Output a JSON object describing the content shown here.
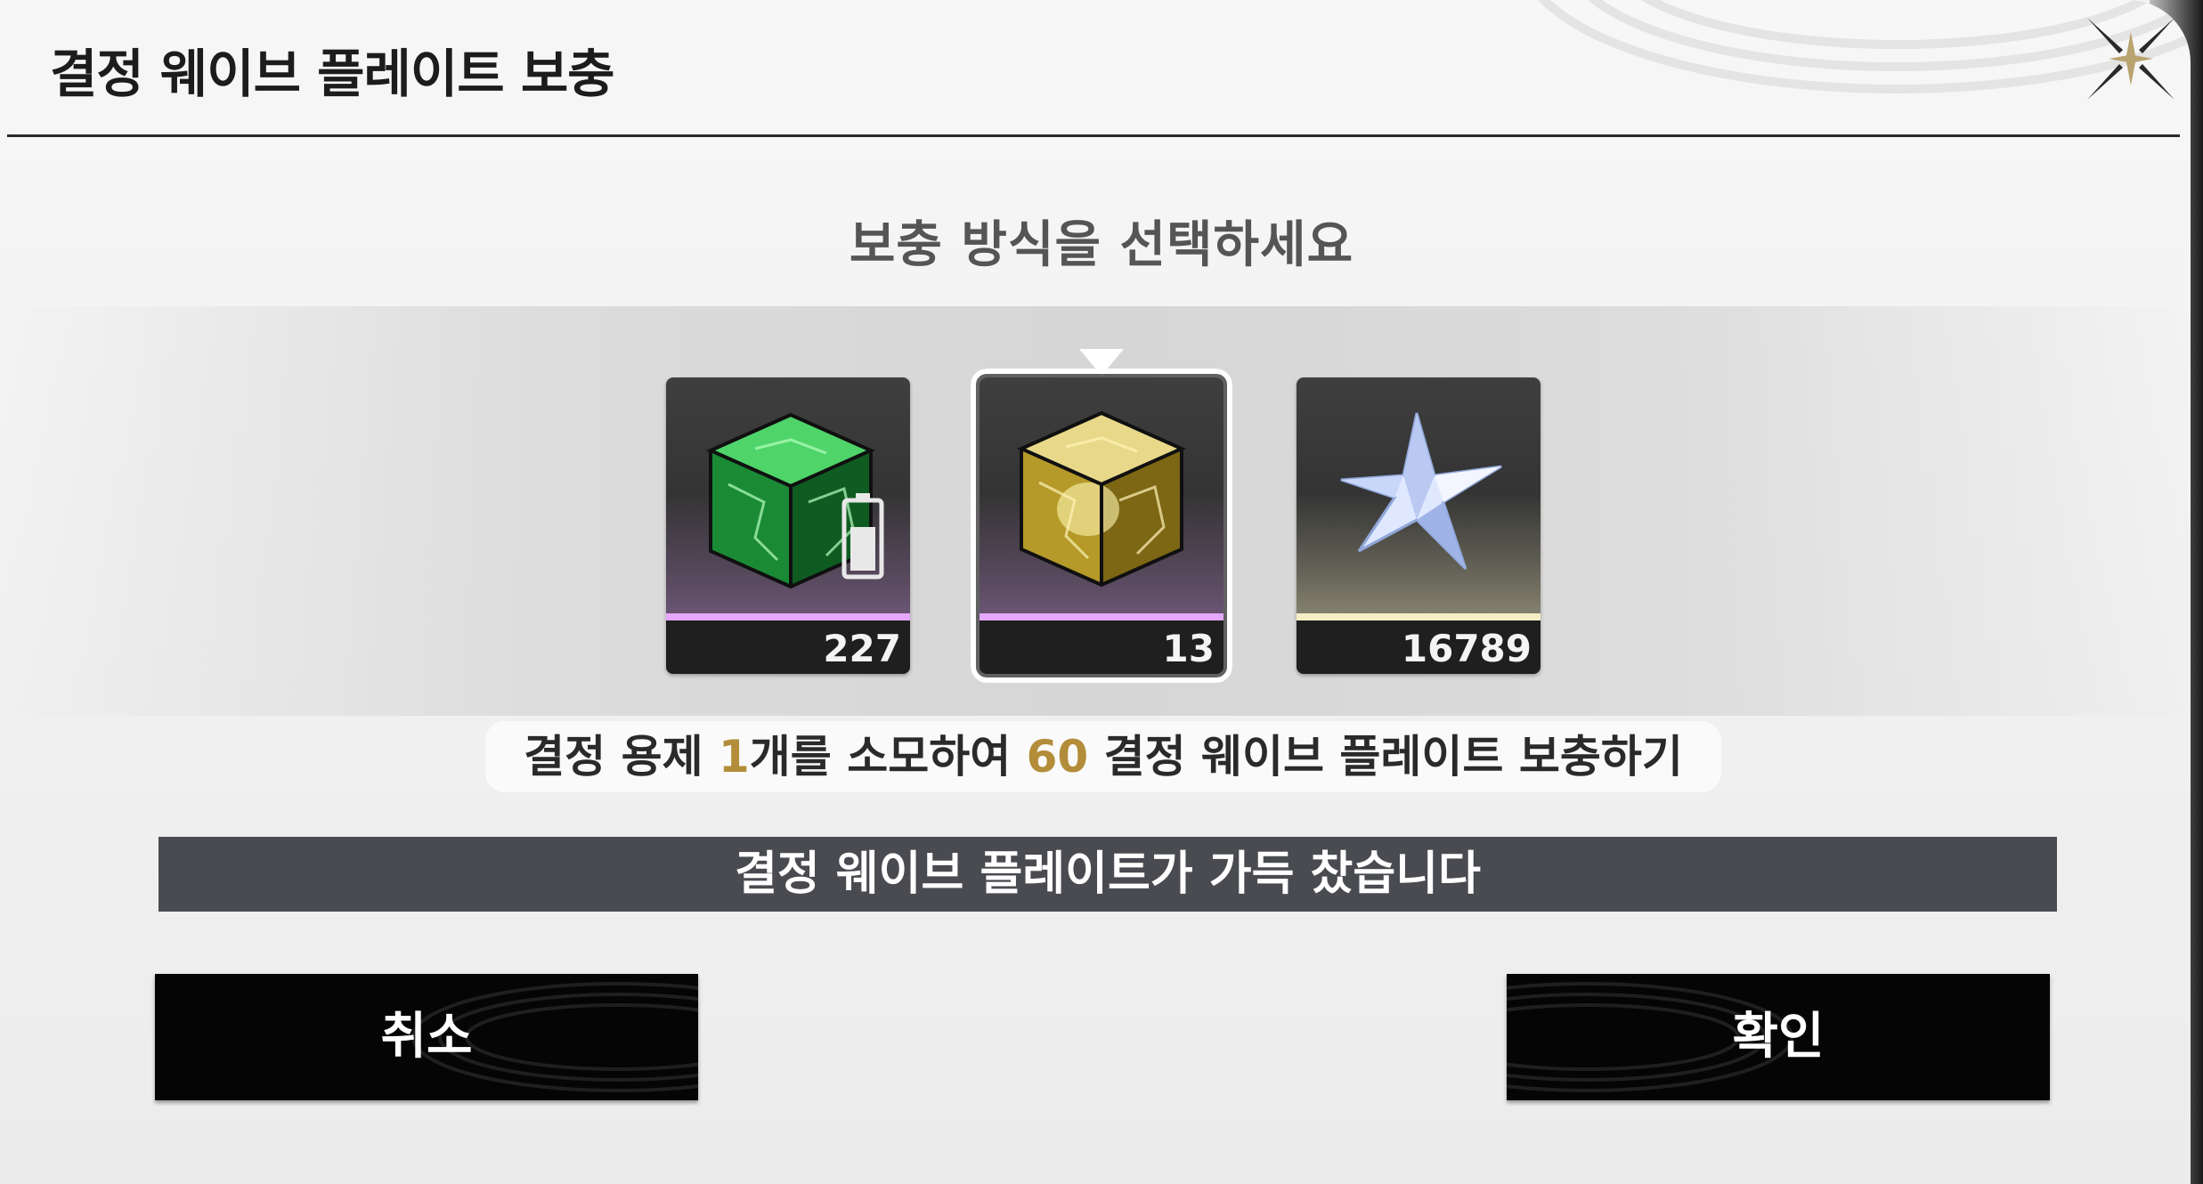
{
  "dialog": {
    "title": "결정 웨이브 플레이트 보충",
    "close_icon": "close-x-icon"
  },
  "subtitle": "보충 방식을 선택하세요",
  "options": [
    {
      "name": "green-crystal-cube",
      "icon": "green-crystal-cube-icon",
      "count": "227",
      "selected": false,
      "accent": "#e6a7ff"
    },
    {
      "name": "gold-crystal-cube",
      "icon": "gold-crystal-cube-icon",
      "count": "13",
      "selected": true,
      "accent": "#e6a7ff"
    },
    {
      "name": "star-crystal",
      "icon": "star-crystal-icon",
      "count": "16789",
      "selected": false,
      "accent": "#f5eec4"
    }
  ],
  "description": {
    "part1": "결정 용제 ",
    "amount_used": "1",
    "part2": "개를 소모하여 ",
    "amount_gained": "60",
    "part3": " 결정 웨이브 플레이트 보충하기",
    "highlight_color": "#b38d3a"
  },
  "status": "결정 웨이브 플레이트가 가득 찼습니다",
  "buttons": {
    "cancel": "취소",
    "confirm": "확인"
  }
}
